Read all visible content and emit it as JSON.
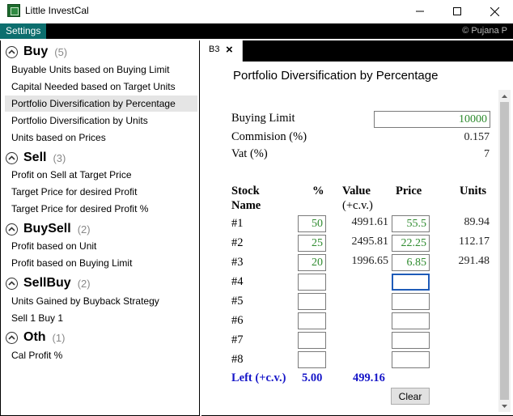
{
  "window": {
    "title": "Little InvestCal"
  },
  "menubar": {
    "settings": "Settings",
    "credit": "© Pujana P"
  },
  "sidebar": {
    "groups": [
      {
        "title": "Buy",
        "count": "(5)",
        "items": [
          "Buyable Units based on Buying Limit",
          "Capital Needed based on Target Units",
          "Portfolio Diversification by Percentage",
          "Portfolio Diversification by Units",
          "Units based on Prices"
        ]
      },
      {
        "title": "Sell",
        "count": "(3)",
        "items": [
          "Profit on Sell at Target Price",
          "Target Price for desired Profit",
          "Target Price for desired Profit %"
        ]
      },
      {
        "title": "BuySell",
        "count": "(2)",
        "items": [
          "Profit based on Unit",
          "Profit based on Buying Limit"
        ]
      },
      {
        "title": "SellBuy",
        "count": "(2)",
        "items": [
          "Units Gained by Buyback Strategy",
          "Sell 1 Buy 1"
        ]
      },
      {
        "title": "Oth",
        "count": "(1)",
        "items": [
          "Cal Profit %"
        ]
      }
    ],
    "selected": "Portfolio Diversification by Percentage"
  },
  "tab": {
    "label": "B3",
    "close": "×"
  },
  "content": {
    "title": "Portfolio Diversification by Percentage",
    "buying_limit_label": "Buying Limit",
    "buying_limit_value": "10000",
    "commission_label": "Commision (%)",
    "commission_value": "0.157",
    "vat_label": "Vat (%)",
    "vat_value": "7",
    "headers": {
      "stock": "Stock",
      "name": "Name",
      "percent": "%",
      "value": "Value",
      "cv": "(+c.v.)",
      "price": "Price",
      "units": "Units"
    },
    "rows": [
      {
        "name": "#1",
        "percent": "50",
        "value": "4991.61",
        "price": "55.5",
        "units": "89.94"
      },
      {
        "name": "#2",
        "percent": "25",
        "value": "2495.81",
        "price": "22.25",
        "units": "112.17"
      },
      {
        "name": "#3",
        "percent": "20",
        "value": "1996.65",
        "price": "6.85",
        "units": "291.48"
      },
      {
        "name": "#4",
        "percent": "",
        "value": "",
        "price": "",
        "units": ""
      },
      {
        "name": "#5",
        "percent": "",
        "value": "",
        "price": "",
        "units": ""
      },
      {
        "name": "#6",
        "percent": "",
        "value": "",
        "price": "",
        "units": ""
      },
      {
        "name": "#7",
        "percent": "",
        "value": "",
        "price": "",
        "units": ""
      },
      {
        "name": "#8",
        "percent": "",
        "value": "",
        "price": "",
        "units": ""
      }
    ],
    "left_label": "Left (+c.v.)",
    "left_percent": "5.00",
    "left_value": "499.16",
    "clear_label": "Clear"
  },
  "colors": {
    "accent": "#0c6e6e",
    "input_text": "#2e8b2e",
    "left_text": "#1616c8"
  },
  "icons": {
    "group": "chevron-up-circle-icon",
    "app": "app-icon",
    "minimize": "minimize-icon",
    "maximize": "maximize-icon",
    "close": "close-icon"
  }
}
